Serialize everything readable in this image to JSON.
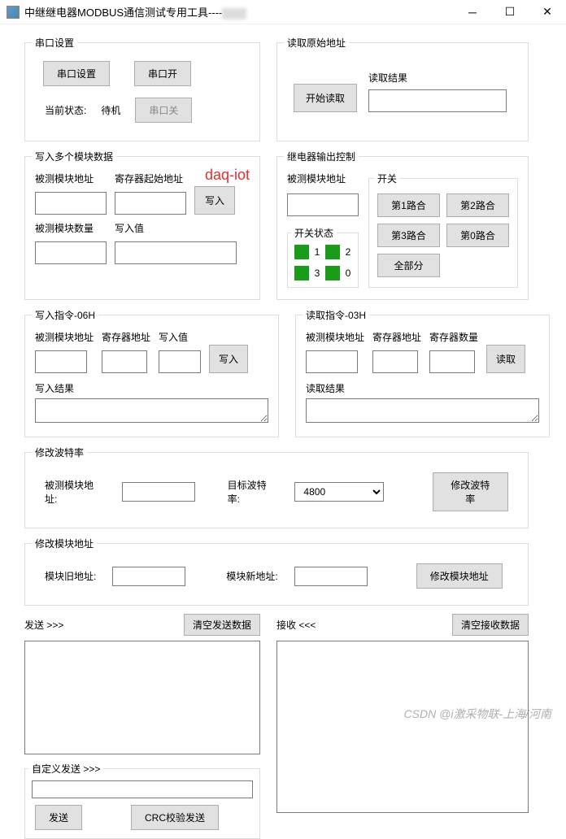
{
  "window": {
    "title": "中继继电器MODBUS通信测试专用工具----"
  },
  "serial": {
    "legend": "串口设置",
    "btn_setup": "串口设置",
    "btn_open": "串口开",
    "btn_close": "串口关",
    "status_label": "当前状态:",
    "status_value": "待机"
  },
  "rawaddr": {
    "legend": "读取原始地址",
    "btn_read": "开始读取",
    "result_label": "读取结果",
    "result_value": ""
  },
  "multi": {
    "legend": "写入多个模块数据",
    "watermark": "daq-iot",
    "module_addr_label": "被测模块地址",
    "reg_start_label": "寄存器起始地址",
    "module_qty_label": "被测模块数量",
    "write_val_label": "写入值",
    "btn_write": "写入",
    "module_addr": "",
    "reg_start": "",
    "module_qty": "",
    "write_val": ""
  },
  "relay": {
    "legend": "继电器输出控制",
    "module_addr_label": "被测模块地址",
    "module_addr": "",
    "switch_status_legend": "开关状态",
    "sw1": "1",
    "sw2": "2",
    "sw3": "3",
    "sw0": "0",
    "switch_legend": "开关",
    "btn1": "第1路合",
    "btn2": "第2路合",
    "btn3": "第3路合",
    "btn0": "第0路合",
    "btn_all": "全部分"
  },
  "cmd06": {
    "legend": "写入指令-06H",
    "module_addr_label": "被测模块地址",
    "reg_addr_label": "寄存器地址",
    "write_val_label": "写入值",
    "btn_write": "写入",
    "result_label": "写入结果",
    "module_addr": "",
    "reg_addr": "",
    "write_val": "",
    "result": ""
  },
  "cmd03": {
    "legend": "读取指令-03H",
    "module_addr_label": "被测模块地址",
    "reg_addr_label": "寄存器地址",
    "reg_qty_label": "寄存器数量",
    "btn_read": "读取",
    "result_label": "读取结果",
    "module_addr": "",
    "reg_addr": "",
    "reg_qty": "",
    "result": ""
  },
  "baud": {
    "legend": "修改波特率",
    "module_addr_label": "被测模块地址:",
    "target_label": "目标波特率:",
    "target_value": "4800",
    "btn_modify": "修改波特率",
    "module_addr": ""
  },
  "addr": {
    "legend": "修改模块地址",
    "old_label": "模块旧地址:",
    "new_label": "模块新地址:",
    "btn_modify": "修改模块地址",
    "old": "",
    "new": ""
  },
  "tx": {
    "send_label": "发送 >>>",
    "recv_label": "接收 <<<",
    "btn_clear_send": "清空发送数据",
    "btn_clear_recv": "清空接收数据",
    "send_text": "",
    "recv_text": "",
    "custom_legend": "自定义发送 >>>",
    "custom_value": "",
    "btn_send": "发送",
    "btn_crc": "CRC校验发送"
  },
  "footer_wm": "CSDN @i激采物联-上海/河南"
}
